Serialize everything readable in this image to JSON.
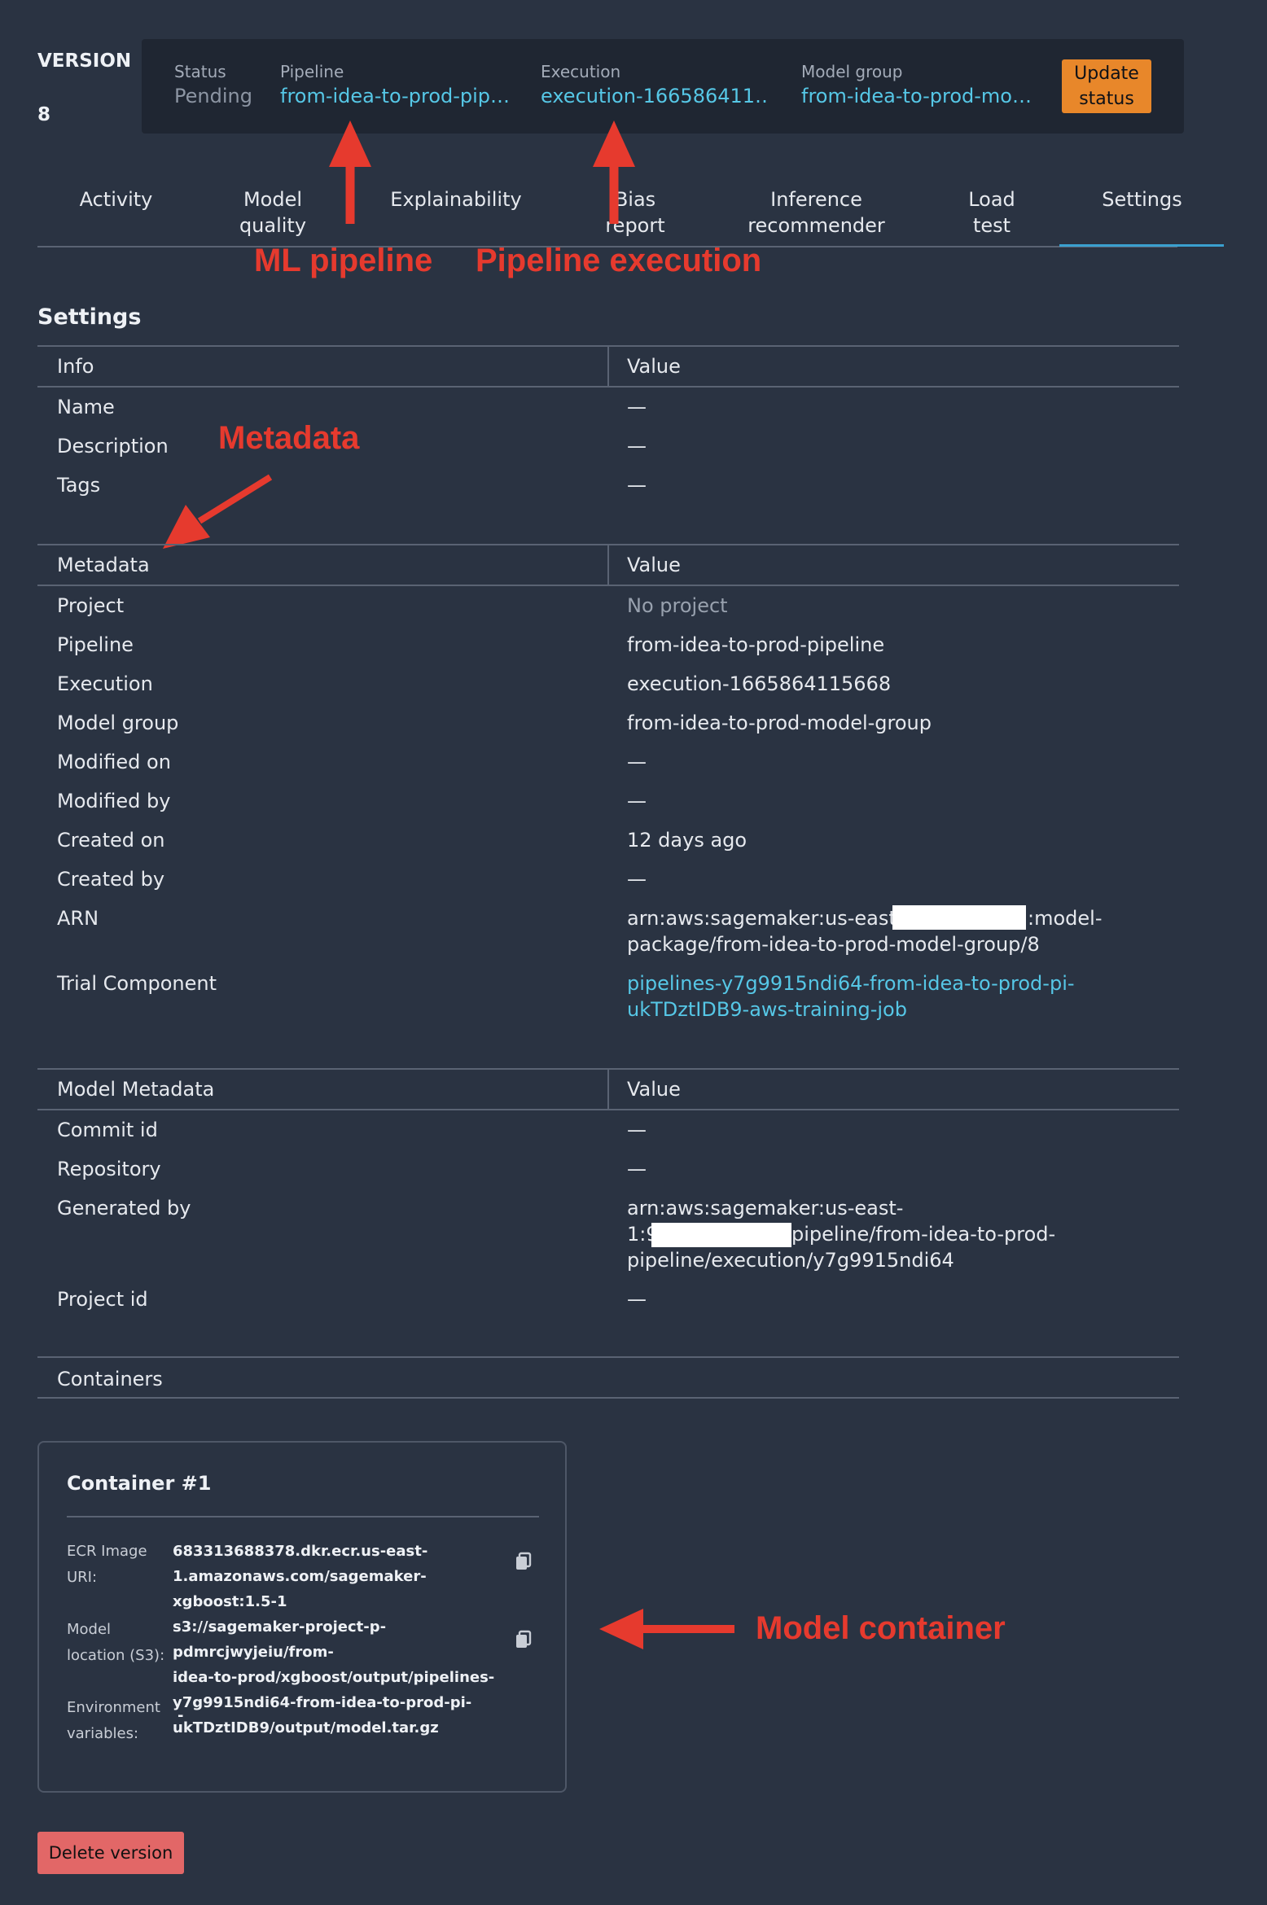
{
  "header": {
    "version_label": "VERSION",
    "version_number": "8",
    "status_label": "Status",
    "status_value": "Pending",
    "pipeline_label": "Pipeline",
    "pipeline_value": "from-idea-to-prod-pip…",
    "execution_label": "Execution",
    "execution_value": "execution-166586411…",
    "model_group_label": "Model group",
    "model_group_value": "from-idea-to-prod-mo…",
    "update_status_line1": "Update",
    "update_status_line2": "status"
  },
  "tabs": [
    {
      "line1": "Activity",
      "line2": ""
    },
    {
      "line1": "Model",
      "line2": "quality"
    },
    {
      "line1": "Explainability",
      "line2": ""
    },
    {
      "line1": "Bias",
      "line2": "report"
    },
    {
      "line1": "Inference",
      "line2": "recommender"
    },
    {
      "line1": "Load",
      "line2": "test"
    },
    {
      "line1": "Settings",
      "line2": ""
    }
  ],
  "annotations": {
    "ml_pipeline": "ML pipeline",
    "pipeline_execution": "Pipeline execution",
    "metadata": "Metadata",
    "model_container": "Model container"
  },
  "settings": {
    "title": "Settings",
    "info_table": {
      "header_key": "Info",
      "header_value": "Value",
      "rows": [
        {
          "key": "Name",
          "value": "—"
        },
        {
          "key": "Description",
          "value": "—"
        },
        {
          "key": "Tags",
          "value": "—"
        }
      ]
    },
    "metadata_table": {
      "header_key": "Metadata",
      "header_value": "Value",
      "rows": [
        {
          "key": "Project",
          "value": "No project"
        },
        {
          "key": "Pipeline",
          "value": "from-idea-to-prod-pipeline"
        },
        {
          "key": "Execution",
          "value": "execution-1665864115668"
        },
        {
          "key": "Model group",
          "value": "from-idea-to-prod-model-group"
        },
        {
          "key": "Modified on",
          "value": "—"
        },
        {
          "key": "Modified by",
          "value": "—"
        },
        {
          "key": "Created on",
          "value": "12 days ago"
        },
        {
          "key": "Created by",
          "value": "—"
        },
        {
          "key": "ARN",
          "value_line1_a": "arn:aws:sagemaker:us-east-1:",
          "value_line1_b": ":model-",
          "value_line2": "package/from-idea-to-prod-model-group/8"
        },
        {
          "key": "Trial Component",
          "value_line1": "pipelines-y7g9915ndi64-from-idea-to-prod-pi-",
          "value_line2": "ukTDztIDB9-aws-training-job"
        }
      ]
    },
    "model_metadata_table": {
      "header_key": "Model Metadata",
      "header_value": "Value",
      "rows": [
        {
          "key": "Commit id",
          "value": "—"
        },
        {
          "key": "Repository",
          "value": "—"
        },
        {
          "key": "Generated by",
          "value_line1": "arn:aws:sagemaker:us-east-",
          "value_line2_a": "1:9",
          "value_line2_b": "pipeline/from-idea-to-prod-",
          "value_line3": "pipeline/execution/y7g9915ndi64"
        },
        {
          "key": "Project id",
          "value": "—"
        }
      ]
    },
    "containers_header": "Containers"
  },
  "container": {
    "title": "Container #1",
    "ecr_label_1": "ECR Image",
    "ecr_label_2": "URI:",
    "ecr_value_1": "683313688378.dkr.ecr.us-east-",
    "ecr_value_2": "1.amazonaws.com/sagemaker-xgboost:1.5-1",
    "model_loc_label_1": "Model",
    "model_loc_label_2": "location (S3):",
    "model_loc_value_1": "s3://sagemaker-project-p-pdmrcjwyjeiu/from-",
    "model_loc_value_2": "idea-to-prod/xgboost/output/pipelines-",
    "model_loc_value_3": "y7g9915ndi64-from-idea-to-prod-pi-",
    "model_loc_value_4": "ukTDztIDB9/output/model.tar.gz",
    "env_label_1": "Environment",
    "env_label_2": "variables:",
    "env_value": "-"
  },
  "actions": {
    "delete_version": "Delete version"
  },
  "colors": {
    "background": "#2a3342",
    "link": "#56c7e6",
    "primary_button": "#e8872a",
    "danger_button": "#e26767",
    "annotation": "#e63a2e"
  },
  "icons": {
    "copy": "copy-icon",
    "arrow": "annotation-arrow"
  }
}
